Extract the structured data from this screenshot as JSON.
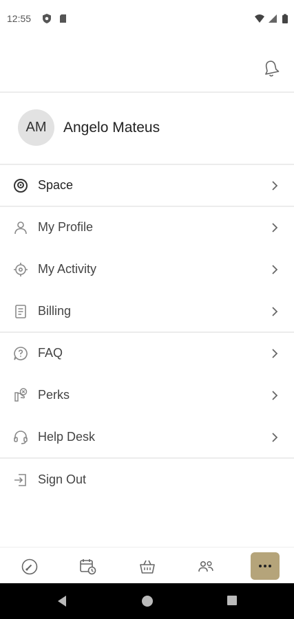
{
  "status_bar": {
    "time": "12:55"
  },
  "profile": {
    "initials": "AM",
    "name": "Angelo Mateus"
  },
  "menu": {
    "space": "Space",
    "my_profile": "My Profile",
    "my_activity": "My Activity",
    "billing": "Billing",
    "faq": "FAQ",
    "perks": "Perks",
    "help_desk": "Help Desk",
    "sign_out": "Sign Out"
  },
  "bottom_nav": {
    "items": [
      "dashboard-icon",
      "calendar-clock-icon",
      "basket-icon",
      "people-icon",
      "more-icon"
    ],
    "active": "more",
    "accent": "#b5a47a"
  }
}
